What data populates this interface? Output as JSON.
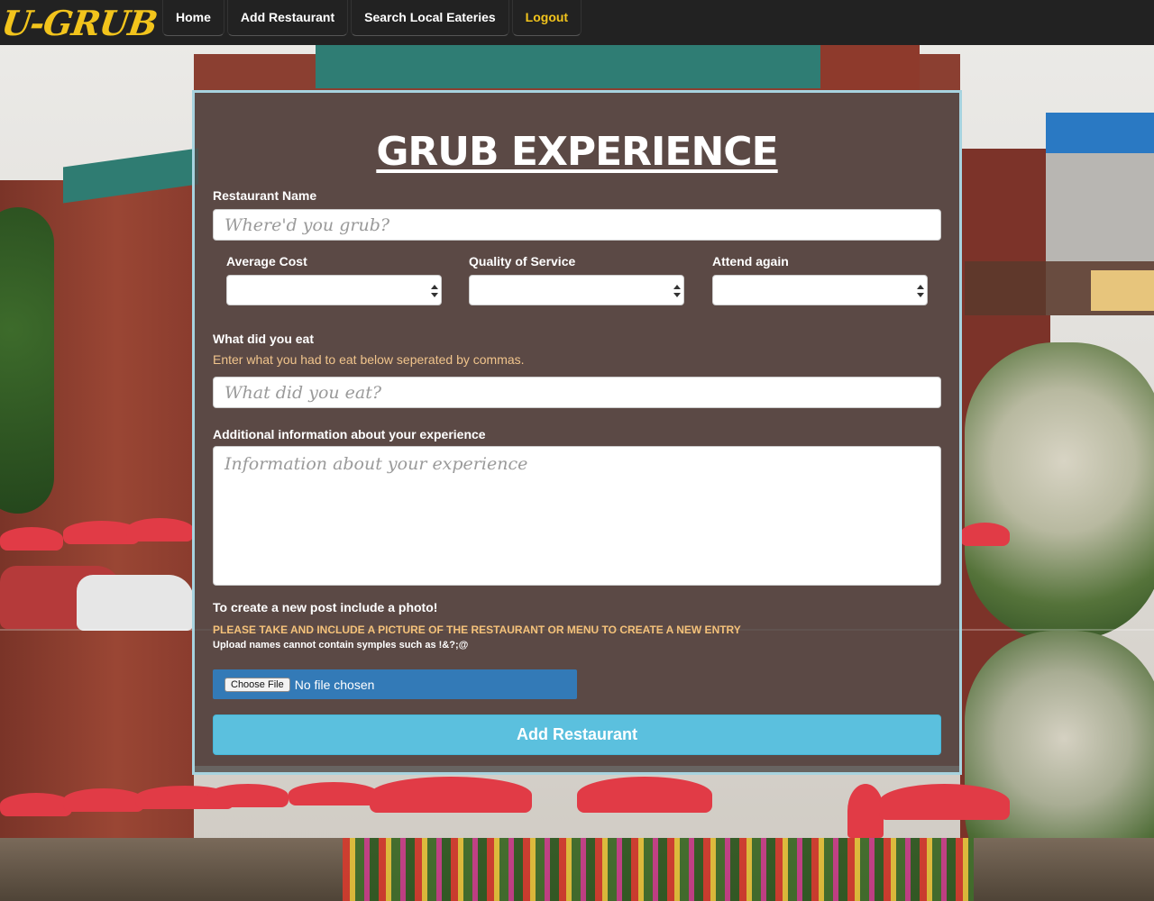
{
  "navbar": {
    "brand": "U-GRUB",
    "links": [
      {
        "label": "Home"
      },
      {
        "label": "Add Restaurant"
      },
      {
        "label": "Search Local Eateries"
      },
      {
        "label": "Logout"
      }
    ]
  },
  "form": {
    "title": "GRUB EXPERIENCE",
    "restaurant_name": {
      "label": "Restaurant Name",
      "placeholder": "Where'd you grub?",
      "value": ""
    },
    "average_cost": {
      "label": "Average Cost",
      "value": ""
    },
    "quality_of_service": {
      "label": "Quality of Service",
      "value": ""
    },
    "attend_again": {
      "label": "Attend again",
      "value": ""
    },
    "what_did_you_eat": {
      "label": "What did you eat",
      "hint": "Enter what you had to eat below seperated by commas.",
      "placeholder": "What did you eat?",
      "value": ""
    },
    "additional_info": {
      "label": "Additional information about your experience",
      "placeholder": "Information about your experience",
      "value": ""
    },
    "photo": {
      "label": "To create a new post include a photo!",
      "instruction": "PLEASE TAKE AND INCLUDE A PICTURE OF THE RESTAURANT OR MENU TO CREATE A NEW ENTRY",
      "note": "Upload names cannot contain symples such as !&?;@",
      "choose_label": "Choose File",
      "status": "No file chosen"
    },
    "submit_label": "Add Restaurant"
  },
  "colors": {
    "navbar_bg": "#222222",
    "brand": "#f2c41c",
    "logout": "#f2c41c",
    "card_border": "#a7d3df",
    "hint": "#f0c48c",
    "submit_bg": "#5bc0de",
    "file_bg": "#337ab7"
  }
}
